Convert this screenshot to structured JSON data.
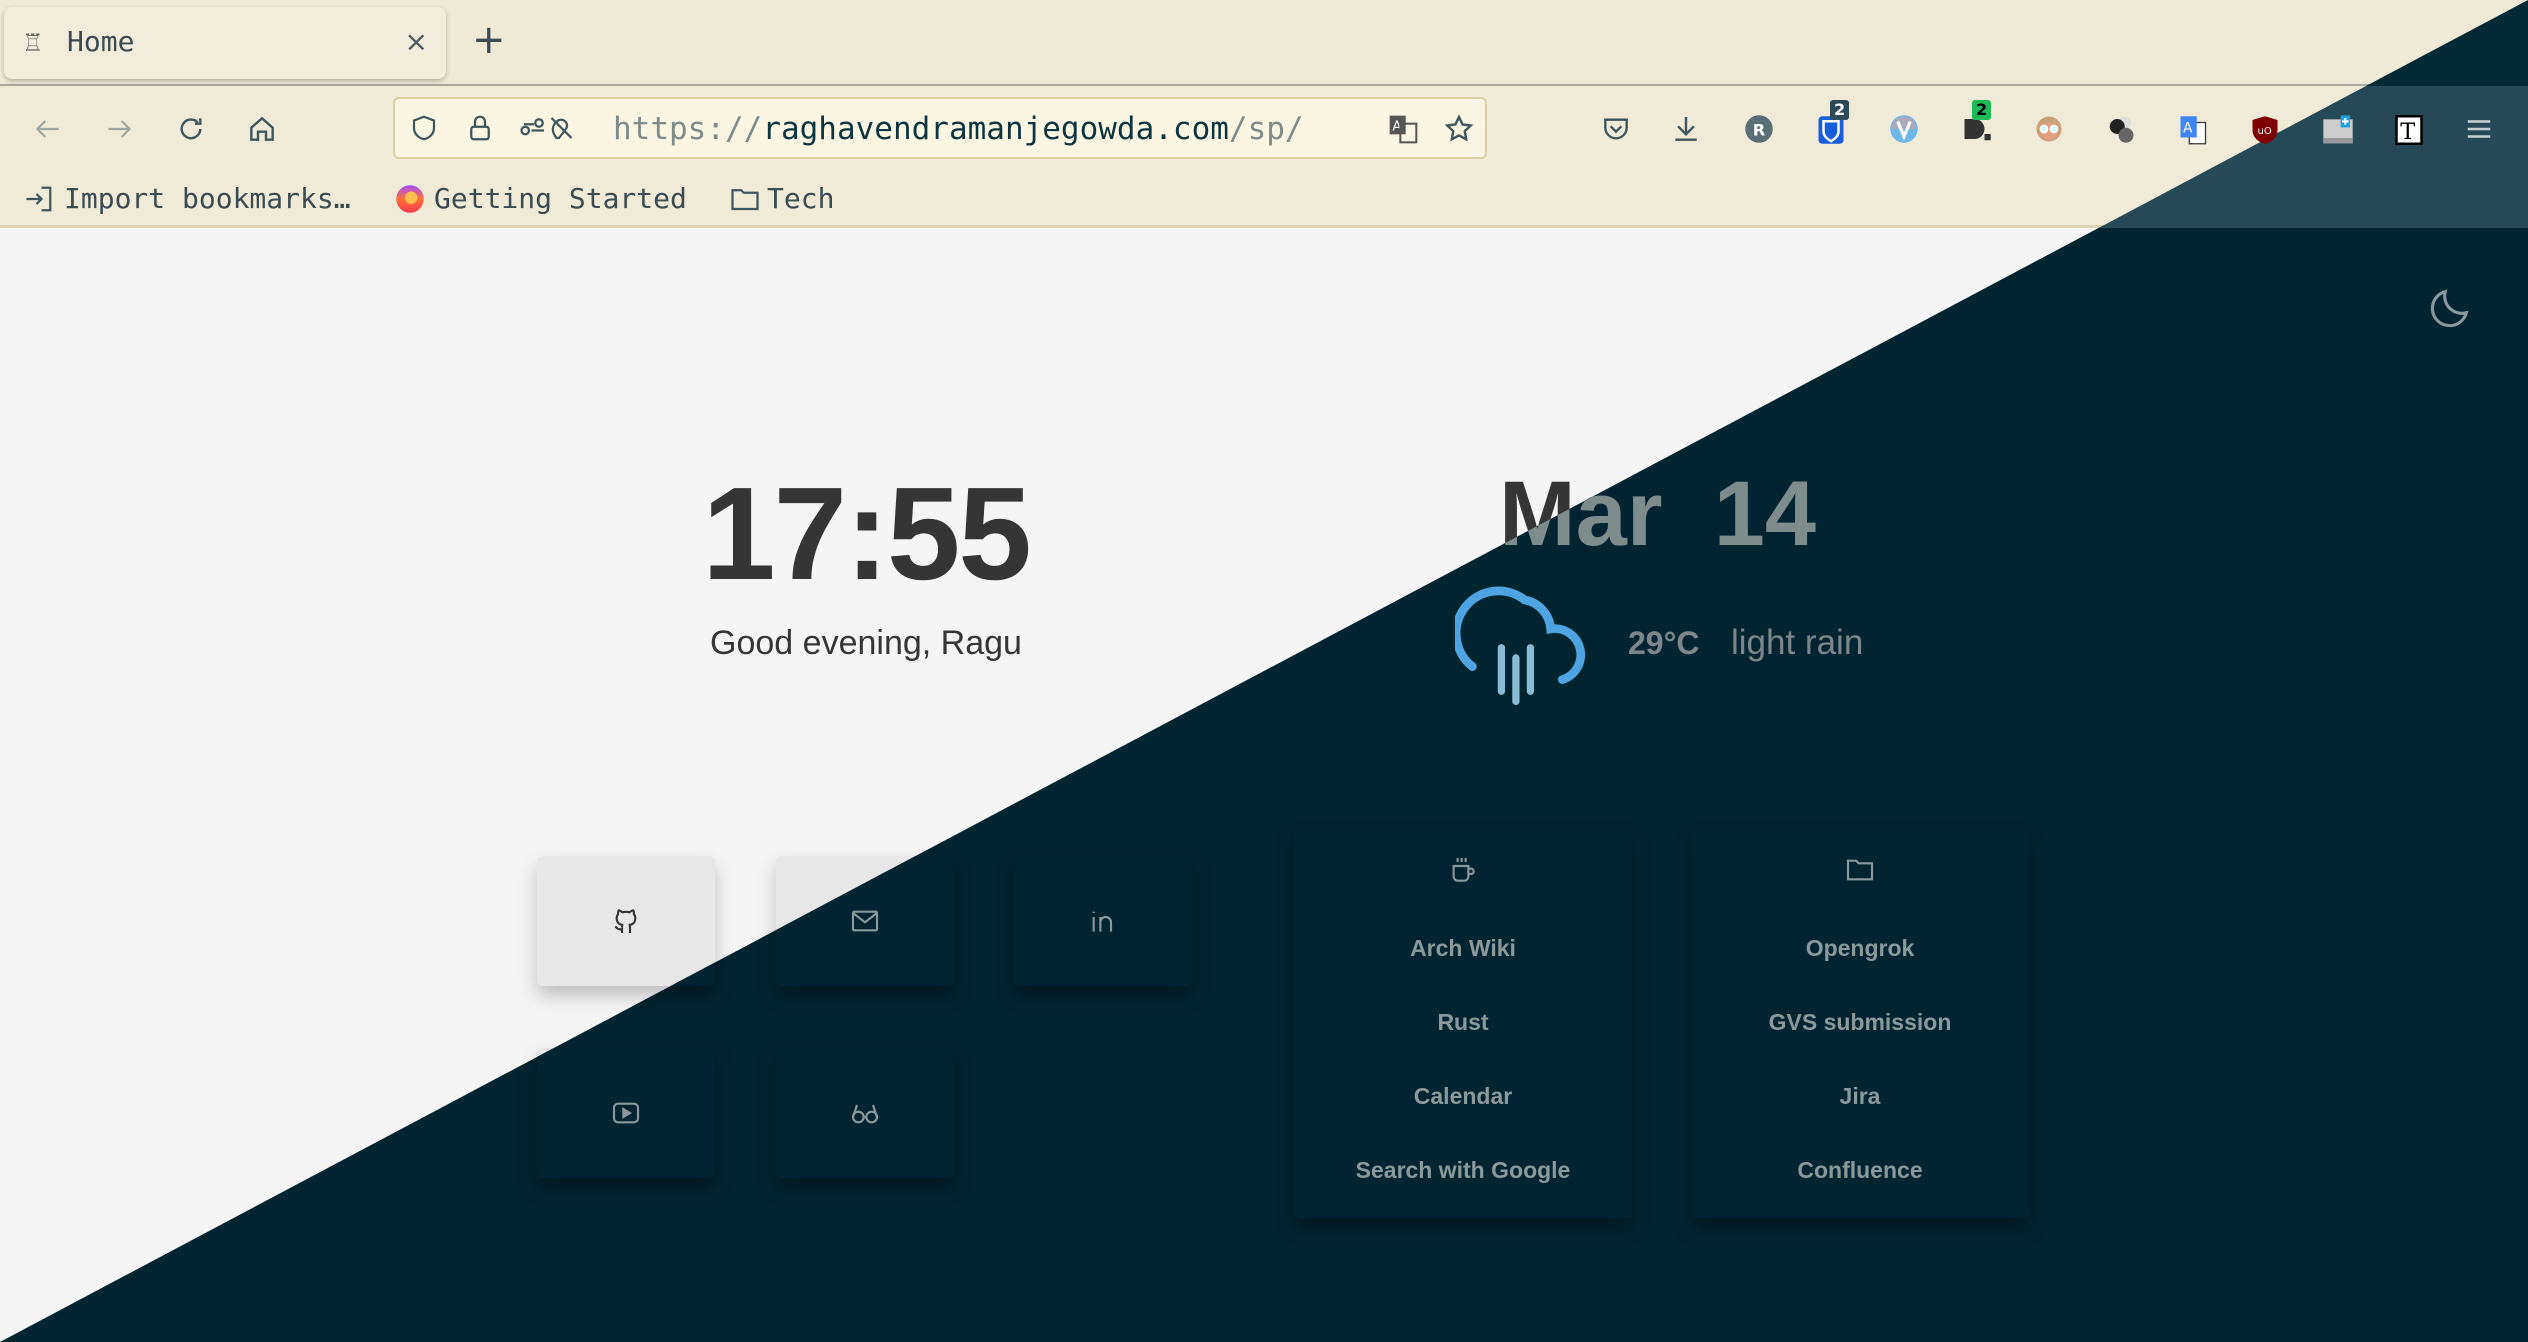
{
  "browser": {
    "tab": {
      "title": "Home",
      "close": "×"
    },
    "new_tab": "+",
    "url": {
      "scheme": "https://",
      "host": "raghavendramanjegowda.com",
      "path": "/sp/"
    },
    "extensions": [
      {
        "name": "pocket-icon"
      },
      {
        "name": "download-icon"
      },
      {
        "name": "r-extension-icon",
        "letter": "R"
      },
      {
        "name": "bitwarden-icon",
        "badge": "2",
        "color": "#175ddc"
      },
      {
        "name": "v-extension-icon"
      },
      {
        "name": "d-extension-icon",
        "badge": "2",
        "badge_color": "#1db954"
      },
      {
        "name": "avatar-extension-icon"
      },
      {
        "name": "spheres-extension-icon"
      },
      {
        "name": "translate-extension-icon"
      },
      {
        "name": "ublock-origin-icon",
        "letter": "uO"
      },
      {
        "name": "tab-extension-icon"
      },
      {
        "name": "text-extension-icon",
        "letter": "T"
      },
      {
        "name": "menu-icon"
      }
    ],
    "bookmarks": [
      {
        "label": "Import bookmarks…",
        "icon": "import-icon"
      },
      {
        "label": "Getting Started",
        "icon": "firefox-icon"
      },
      {
        "label": "Tech",
        "icon": "folder-icon"
      }
    ]
  },
  "page": {
    "clock": "17:55",
    "greeting": "Good evening, Ragu",
    "date": "Mar  14",
    "weather": {
      "temperature": "29°C",
      "condition": "light rain",
      "icon": "cloud-rain-icon"
    },
    "theme_toggle": "moon-icon",
    "quick_links": [
      {
        "icon": "github-icon"
      },
      {
        "icon": "mail-icon"
      },
      {
        "icon": "linkedin-icon"
      },
      {
        "icon": "youtube-icon"
      },
      {
        "icon": "glasses-icon"
      }
    ],
    "lists": [
      {
        "icon": "coffee-icon",
        "items": [
          "Arch Wiki",
          "Rust",
          "Calendar",
          "Search with Google"
        ]
      },
      {
        "icon": "folder-icon",
        "items": [
          "Opengrok",
          "GVS submission",
          "Jira",
          "Confluence"
        ]
      }
    ],
    "colors": {
      "light_bg": "#f5f5f5",
      "dark_bg": "#012530",
      "weather_blue": "#4fa3e0"
    }
  }
}
